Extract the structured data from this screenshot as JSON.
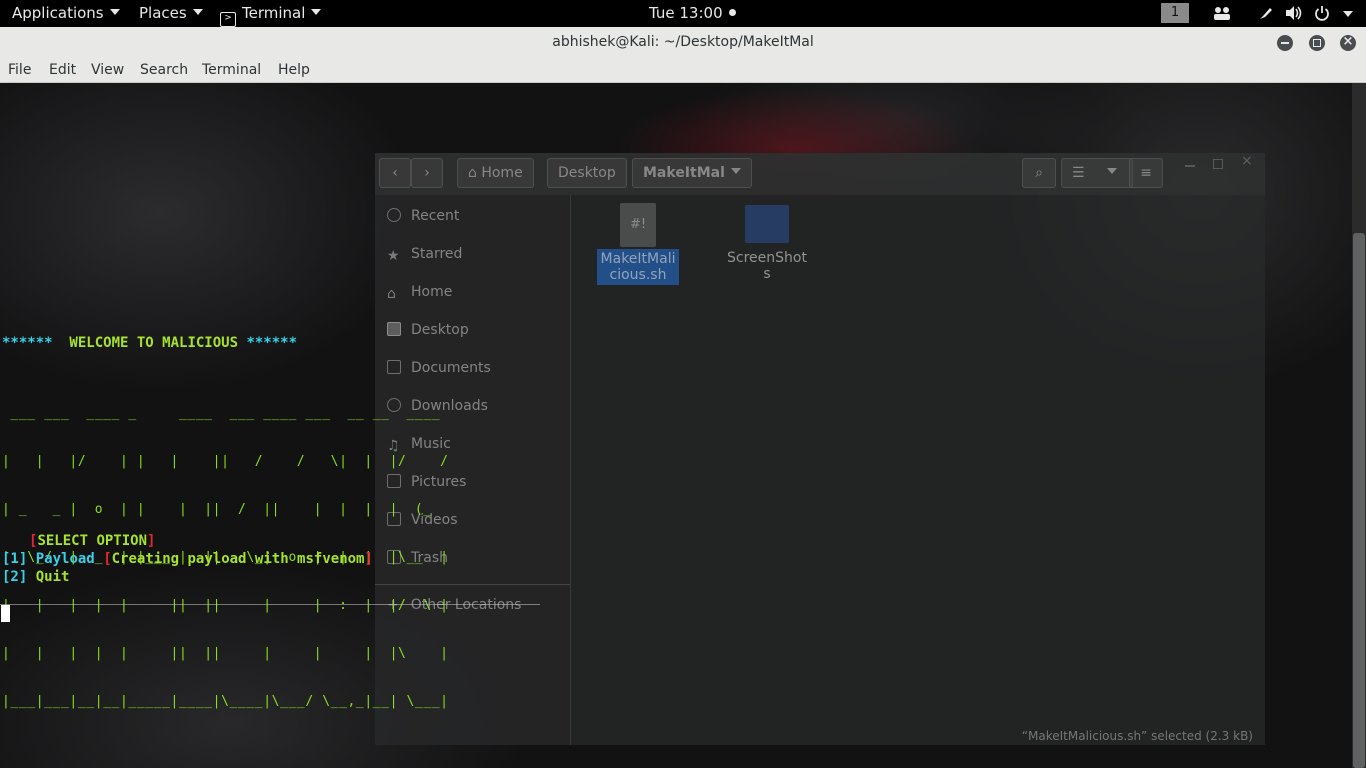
{
  "topbar": {
    "applications": "Applications",
    "places": "Places",
    "terminal": "Terminal",
    "clock": "Tue 13:00",
    "workspace": "1"
  },
  "window": {
    "title": "abhishek@Kali: ~/Desktop/MakeItMal"
  },
  "menu": [
    "File",
    "Edit",
    "View",
    "Search",
    "Terminal",
    "Help"
  ],
  "terminal": {
    "welcome_stars_left": "******",
    "welcome_text": "  WELCOME TO MALICIOUS ",
    "welcome_stars_right": "******",
    "banner": [
      " ___ ___  ____ _     ____  ___ ____ ___  __ __  ____ ",
      "|   |   |/    | |   |    ||   /    /   \\|  |  |/    /",
      "| _   _ |  o  | |    |  ||  /  ||    |  |  |  |  (_ ",
      "|  \\_/  |  _  | |___ |  ||   \\_|  o  |  |  |  |\\__  |",
      "|   |   |  |  |     ||  ||     |     |  :  |  |/  \\ |",
      "|   |   |  |  |     ||  ||     |     |     |  |\\    |",
      "|___|___|__|__|_____|____|\\____|\\___/ \\__,_|__| \\___|"
    ],
    "select_open": "[",
    "select_label": "SELECT OPTION",
    "select_close": "]",
    "opt1_num": "[1]",
    "opt1_label": "Payload",
    "opt1_br_open": "[",
    "opt1_desc": "Creating payload with msfvenom",
    "opt1_br_close": "]",
    "opt2_num": "[2]",
    "opt2_label": "Quit"
  },
  "file_manager": {
    "path": [
      "Home",
      "Desktop",
      "MakeItMal"
    ],
    "sidebar": [
      "Recent",
      "Starred",
      "Home",
      "Desktop",
      "Documents",
      "Downloads",
      "Music",
      "Pictures",
      "Videos",
      "Trash",
      "Other Locations"
    ],
    "files": [
      {
        "name_line1": "MakeItMali",
        "name_line2": "cious.sh",
        "icon": "#!"
      },
      {
        "name_line1": "ScreenShot",
        "name_line2": "s"
      }
    ],
    "status": "“MakeItMalicious.sh” selected  (2.3 kB)"
  },
  "colors": {
    "cyan": "#3ad0e6",
    "green": "#a6e22e",
    "red": "#e0282e",
    "banner_green": "#86e01c"
  }
}
